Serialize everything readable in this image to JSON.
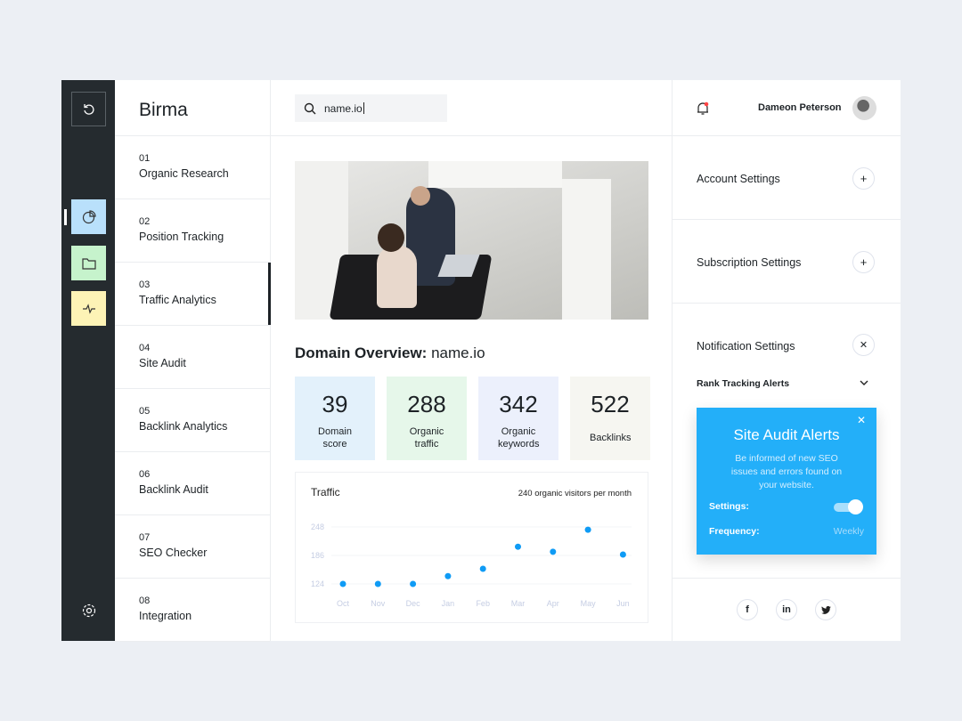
{
  "brand": "Birma",
  "nav": [
    {
      "n": "01",
      "label": "Organic Research"
    },
    {
      "n": "02",
      "label": "Position Tracking"
    },
    {
      "n": "03",
      "label": "Traffic Analytics"
    },
    {
      "n": "04",
      "label": "Site Audit"
    },
    {
      "n": "05",
      "label": "Backlink Analytics"
    },
    {
      "n": "06",
      "label": "Backlink Audit"
    },
    {
      "n": "07",
      "label": "SEO Checker"
    },
    {
      "n": "08",
      "label": "Integration"
    }
  ],
  "search": {
    "value": "name.io"
  },
  "overview": {
    "title": "Domain Overview:",
    "domain": "name.io"
  },
  "stats": [
    {
      "value": "39",
      "label": "Domain score",
      "color": "#e3f1fb"
    },
    {
      "value": "288",
      "label": "Organic traffic",
      "color": "#e6f7ea"
    },
    {
      "value": "342",
      "label": "Organic keywords",
      "color": "#ecf0fc"
    },
    {
      "value": "522",
      "label": "Backlinks",
      "color": "#f6f6f1"
    }
  ],
  "user": {
    "name": "Dameon Peterson"
  },
  "settings": {
    "account": "Account Settings",
    "subscription": "Subscription Settings",
    "notification": "Notification Settings",
    "rank": "Rank Tracking Alerts"
  },
  "alert": {
    "title": "Site Audit Alerts",
    "text": "Be informed of new SEO issues and errors found on your website.",
    "settings_label": "Settings:",
    "settings_on": true,
    "frequency_label": "Frequency:",
    "frequency": "Weekly"
  },
  "social": [
    "f",
    "in",
    "t"
  ],
  "chart_data": {
    "type": "scatter",
    "title": "Traffic",
    "subtitle": "240 organic visitors per month",
    "categories": [
      "Oct",
      "Nov",
      "Dec",
      "Jan",
      "Feb",
      "Mar",
      "Apr",
      "May",
      "Jun"
    ],
    "values": [
      124,
      124,
      124,
      141,
      157,
      205,
      194,
      242,
      188
    ],
    "yticks": [
      124,
      186,
      248
    ],
    "ylim": [
      124,
      248
    ],
    "color": "#0f9bf5"
  }
}
